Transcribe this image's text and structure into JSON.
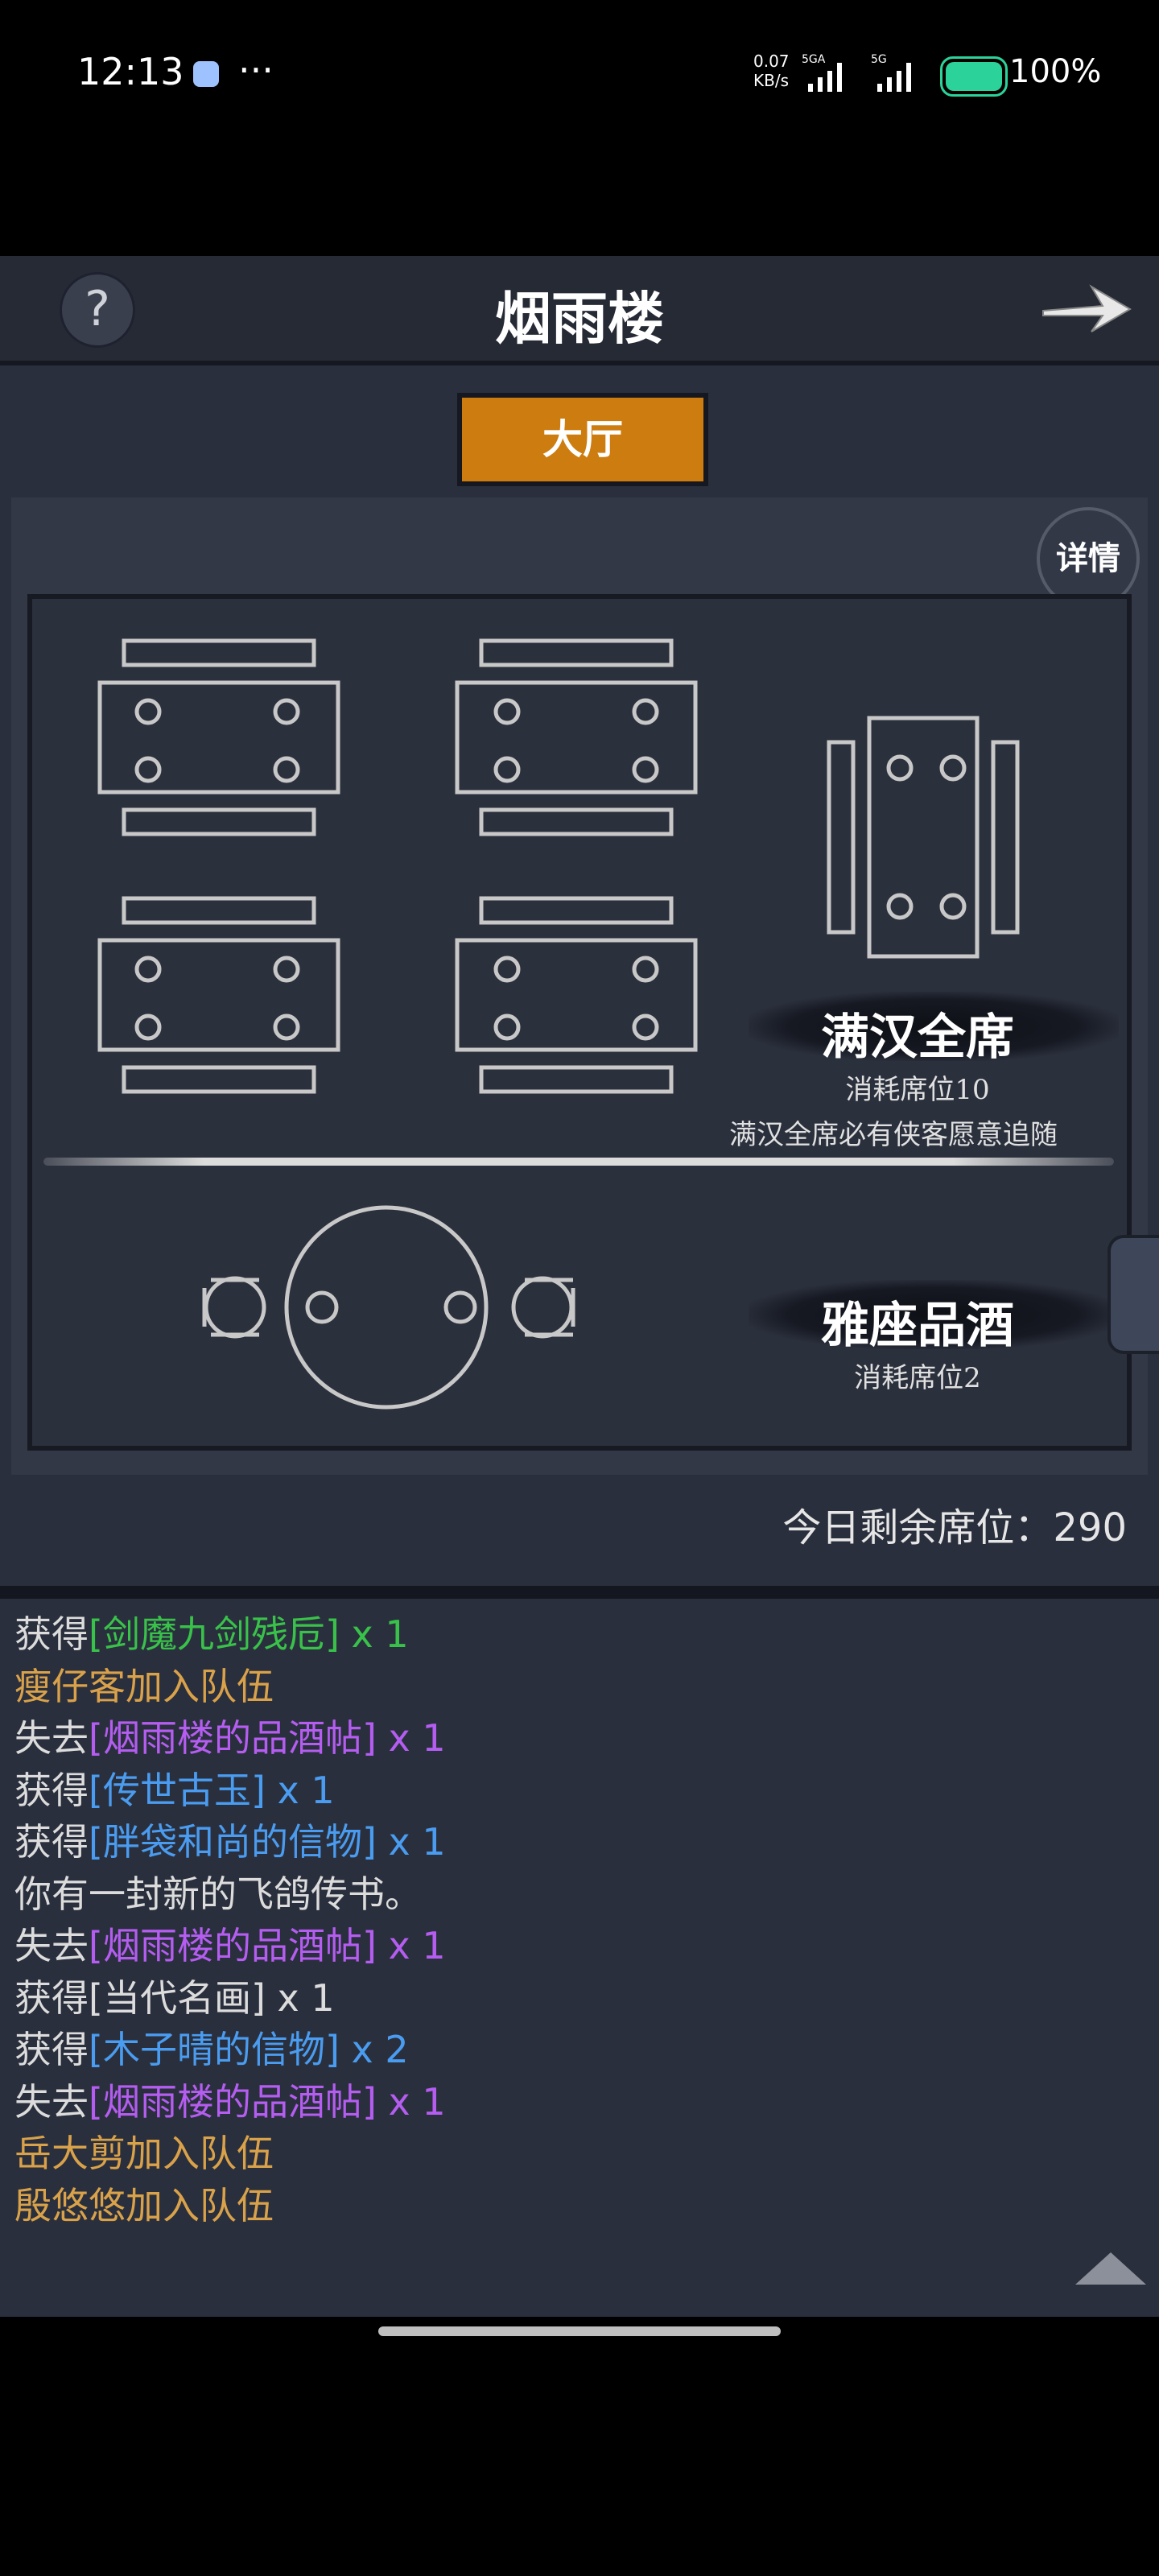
{
  "status_bar": {
    "time": "12:13",
    "more": "···",
    "net_speed_line1": "0.07",
    "net_speed_line2": "KB/s",
    "net1": "5GA",
    "net2": "5G",
    "battery": "100%"
  },
  "header": {
    "title": "烟雨楼",
    "help_label": "?"
  },
  "tab": {
    "label": "大厅"
  },
  "panel": {
    "detail_label": "详情",
    "feast": {
      "title": "满汉全席",
      "cost": "消耗席位10",
      "desc": "满汉全席必有侠客愿意追随"
    },
    "seat": {
      "title": "雅座品酒",
      "cost": "消耗席位2"
    },
    "remaining": "今日剩余席位：290"
  },
  "log": [
    [
      {
        "t": "获得",
        "c": "white"
      },
      {
        "t": "[剑魔九剑残卮] x 1",
        "c": "green"
      }
    ],
    [
      {
        "t": "瘦仔客加入队伍",
        "c": "orange"
      }
    ],
    [
      {
        "t": "失去",
        "c": "white"
      },
      {
        "t": "[烟雨楼的品酒帖] x 1",
        "c": "purple"
      }
    ],
    [
      {
        "t": "获得",
        "c": "white"
      },
      {
        "t": "[传世古玉] x 1",
        "c": "blue"
      }
    ],
    [
      {
        "t": "获得",
        "c": "white"
      },
      {
        "t": "[胖袋和尚的信物] x 1",
        "c": "blue"
      }
    ],
    [
      {
        "t": "你有一封新的飞鸽传书。",
        "c": "white"
      }
    ],
    [
      {
        "t": "失去",
        "c": "white"
      },
      {
        "t": "[烟雨楼的品酒帖] x 1",
        "c": "purple"
      }
    ],
    [
      {
        "t": "获得",
        "c": "white"
      },
      {
        "t": "[当代名画] x 1",
        "c": "white"
      }
    ],
    [
      {
        "t": "获得",
        "c": "white"
      },
      {
        "t": "[木子晴的信物] x 2",
        "c": "blue"
      }
    ],
    [
      {
        "t": "失去",
        "c": "white"
      },
      {
        "t": "[烟雨楼的品酒帖] x 1",
        "c": "purple"
      }
    ],
    [
      {
        "t": "岳大剪加入队伍",
        "c": "orange"
      }
    ],
    [
      {
        "t": "殷悠悠加入队伍",
        "c": "orange"
      }
    ]
  ]
}
